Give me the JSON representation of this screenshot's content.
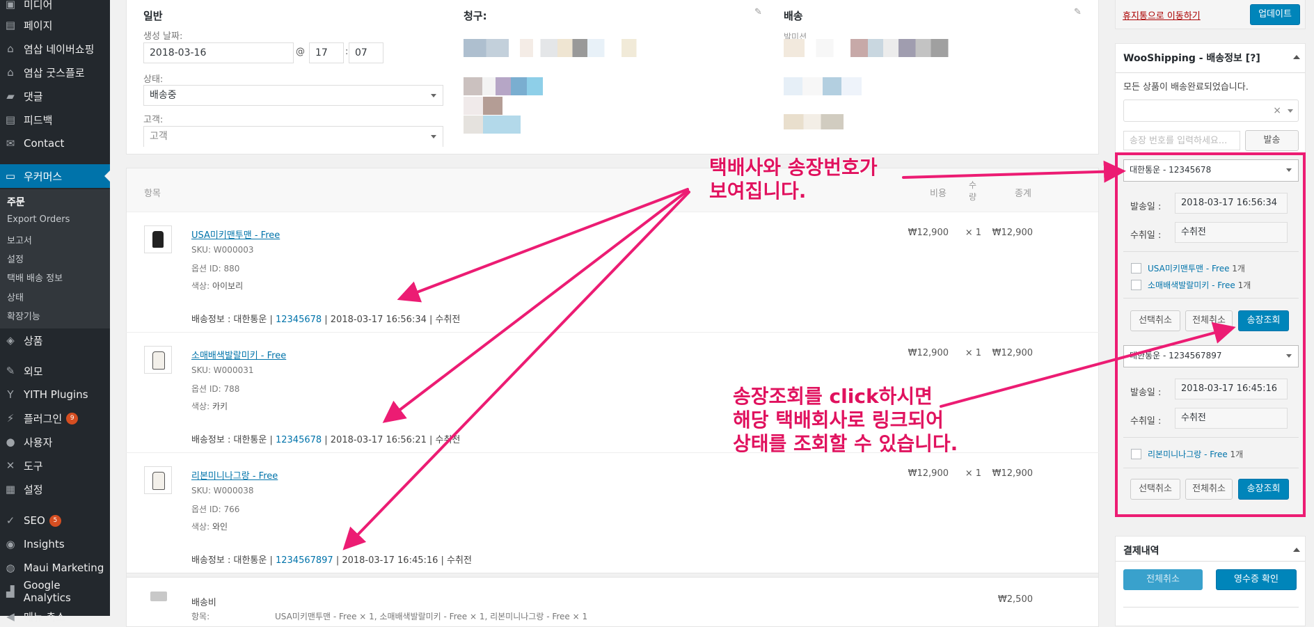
{
  "sidebar": {
    "items": [
      {
        "label": "미디어",
        "icon": "media-icon"
      },
      {
        "label": "페이지",
        "icon": "page-icon"
      },
      {
        "label": "염삽 네이버쇼핑",
        "icon": "store-icon"
      },
      {
        "label": "염삽 굿스플로",
        "icon": "store-icon"
      },
      {
        "label": "댓글",
        "icon": "comment-icon"
      },
      {
        "label": "피드백",
        "icon": "feedback-icon"
      },
      {
        "label": "Contact",
        "icon": "mail-icon"
      },
      {
        "label": "우커머스",
        "icon": "woo-icon"
      },
      {
        "label": "상품",
        "icon": "box-icon"
      },
      {
        "label": "외모",
        "icon": "brush-icon"
      },
      {
        "label": "YITH Plugins",
        "icon": "yith-icon"
      },
      {
        "label": "플러그인",
        "icon": "plugin-icon",
        "badge": "9"
      },
      {
        "label": "사용자",
        "icon": "user-icon"
      },
      {
        "label": "도구",
        "icon": "wrench-icon"
      },
      {
        "label": "설정",
        "icon": "settings-icon"
      },
      {
        "label": "SEO",
        "icon": "seo-icon",
        "badge": "5"
      },
      {
        "label": "Insights",
        "icon": "insights-icon"
      },
      {
        "label": "Maui Marketing",
        "icon": "maui-icon"
      },
      {
        "label": "Google Analytics",
        "icon": "analytics-icon"
      },
      {
        "label": "메뉴 축소",
        "icon": "collapse-icon"
      }
    ],
    "submenu": [
      "주문",
      "Export Orders",
      "보고서",
      "설정",
      "택배 배송 정보",
      "상태",
      "확장기능"
    ]
  },
  "order": {
    "general_title": "일반",
    "created_label": "생성 날짜:",
    "date": "2018-03-16",
    "at": "@",
    "hour": "17",
    "colon": ":",
    "minute": "07",
    "status_label": "상태:",
    "status_value": "배송중",
    "customer_label": "고객:",
    "customer_value": "고객",
    "billing_title": "청구:",
    "shipping_title": "배송",
    "shipping_method": "발미션"
  },
  "items": {
    "col_item": "항목",
    "col_cost": "비용",
    "col_qty": "수량",
    "col_total": "종계",
    "rows": [
      {
        "name": "USA미키맨투맨 - Free",
        "sku": "SKU: W000003",
        "option": "옵션 ID: 880",
        "color_label": "색상:",
        "color": "아이보리",
        "cost": "₩12,900",
        "qty": "× 1",
        "total": "₩12,900",
        "ship_prefix": "배송정보 : 대한통운 | ",
        "tracking": "12345678",
        "ship_suffix": " | 2018-03-17 16:56:34 | 수취전"
      },
      {
        "name": "소매배색발랄미키 - Free",
        "sku": "SKU: W000031",
        "option": "옵션 ID: 788",
        "color_label": "색상:",
        "color": "카키",
        "cost": "₩12,900",
        "qty": "× 1",
        "total": "₩12,900",
        "ship_prefix": "배송정보 : 대한통운 | ",
        "tracking": "12345678",
        "ship_suffix": " | 2018-03-17 16:56:21 | 수취전"
      },
      {
        "name": "리본미니나그랑 - Free",
        "sku": "SKU: W000038",
        "option": "옵션 ID: 766",
        "color_label": "색상:",
        "color": "와인",
        "cost": "₩12,900",
        "qty": "× 1",
        "total": "₩12,900",
        "ship_prefix": "배송정보 : 대한통운 | ",
        "tracking": "1234567897",
        "ship_suffix": " | 2018-03-17 16:45:16 | 수취전"
      }
    ],
    "shipping_fee_label": "배송비",
    "shipping_fee_value": "₩2,500",
    "shipping_fee_detail_label": "항목:",
    "shipping_fee_detail": "USA미키맨투맨 - Free × 1, 소매배색발랄미키 - Free × 1, 리본미니나그랑 - Free × 1"
  },
  "right": {
    "trash_link": "휴지통으로 이동하기",
    "update_button": "업데이트",
    "wooshipping_title": "WooShipping - 배송정보 [?]",
    "all_shipped": "모든 상품이 배송완료되었습니다.",
    "tracking_placeholder": "송장 번호를 입력하세요...",
    "send_button": "발송",
    "shipments": [
      {
        "header": "대한통운 - 12345678",
        "sent_label": "발송일 :",
        "sent_value": "2018-03-17 16:56:34",
        "recv_label": "수취일 :",
        "recv_value": "수취전",
        "products": [
          {
            "name": "USA미키맨투맨 - Free",
            "qty": "1개"
          },
          {
            "name": "소매배색발랄미키 - Free",
            "qty": "1개"
          }
        ]
      },
      {
        "header": "대한통운 - 1234567897",
        "sent_label": "발송일 :",
        "sent_value": "2018-03-17 16:45:16",
        "recv_label": "수취일 :",
        "recv_value": "수취전",
        "products": [
          {
            "name": "리본미니나그랑 - Free",
            "qty": "1개"
          }
        ]
      }
    ],
    "cancel_selected": "선택취소",
    "cancel_all": "전체취소",
    "track_button": "송장조회",
    "payment_title": "결제내역",
    "payment_cancel_all": "전체취소",
    "receipt_button": "영수증 확인"
  },
  "annotations": {
    "top_line1": "택배사와 송장번호가",
    "top_line2": "보여집니다.",
    "bottom_line1": "송장조회를 click하시면",
    "bottom_line2": "해당 택배회사로 링크되어",
    "bottom_line3": "상태를 조회할 수 있습니다."
  },
  "colors": {
    "accent": "#0073aa",
    "annotation": "#e0125e",
    "sidebar": "#23282d",
    "primary_button": "#0085ba"
  }
}
